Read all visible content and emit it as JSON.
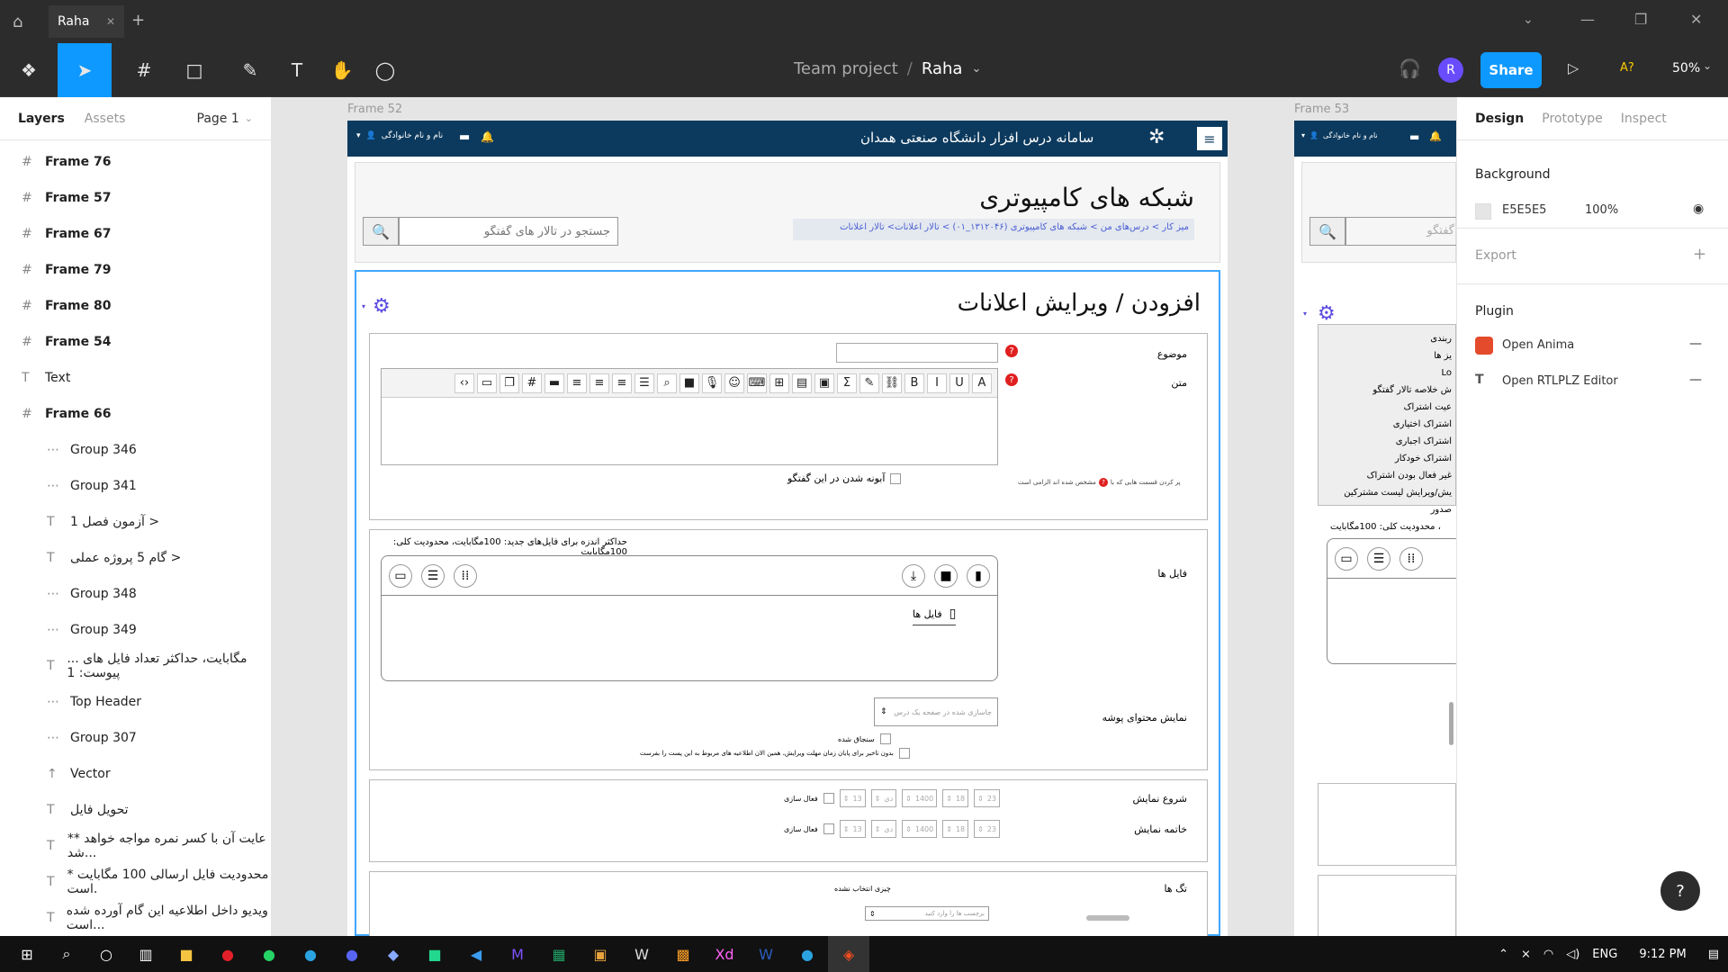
{
  "titlebar": {
    "tab_label": "Raha"
  },
  "toolbar": {
    "project": "Team project",
    "separator": "/",
    "file": "Raha",
    "share": "Share",
    "avatar_initial": "R",
    "ai_label": "A?",
    "zoom": "50%"
  },
  "layers_panel": {
    "tab_layers": "Layers",
    "tab_assets": "Assets",
    "page": "Page 1",
    "items": [
      {
        "type": "frame",
        "label": "Frame 76"
      },
      {
        "type": "frame",
        "label": "Frame 57"
      },
      {
        "type": "frame",
        "label": "Frame 67"
      },
      {
        "type": "frame",
        "label": "Frame 79"
      },
      {
        "type": "frame",
        "label": "Frame 80"
      },
      {
        "type": "frame",
        "label": "Frame 54"
      },
      {
        "type": "text",
        "label": "Text"
      },
      {
        "type": "frame",
        "label": "Frame 66"
      },
      {
        "type": "group",
        "label": "Group 346"
      },
      {
        "type": "group",
        "label": "Group 341"
      },
      {
        "type": "text",
        "label": "آزمون فصل 1 >"
      },
      {
        "type": "text",
        "label": "گام 5 پروژه عملی >"
      },
      {
        "type": "group",
        "label": "Group 348"
      },
      {
        "type": "group",
        "label": "Group 349"
      },
      {
        "type": "text",
        "label": "... مگابایت، حداکثر تعداد فایل های پیوست: 1"
      },
      {
        "type": "group",
        "label": "Top Header"
      },
      {
        "type": "group",
        "label": "Group 307"
      },
      {
        "type": "vector",
        "label": "Vector"
      },
      {
        "type": "text",
        "label": "تحویل فایل"
      },
      {
        "type": "text",
        "label": "** عایت آن با کسر نمره مواجه خواهد شد..."
      },
      {
        "type": "text",
        "label": "* محدودیت فایل ارسالی 100 مگابایت است."
      },
      {
        "type": "text",
        "label": "ویدیو داخل اطلاعیه این گام آورده شده است..."
      }
    ]
  },
  "canvas": {
    "frame52_label": "Frame 52",
    "frame53_label": "Frame 53",
    "site": {
      "user_name": "نام و نام خانوادگی",
      "site_title": "سامانه درس افزار دانشگاه صنعتی همدان",
      "course_title": "شبکه های کامپیوتری",
      "search_placeholder": "جستجو در تالار های گفتگو",
      "breadcrumb": "میز کار > درس‌های من > شبکه های کامپیوتری (۱۳۱۲۰۴۶_۰۱) > تالار اعلانات> تالار اعلانات",
      "page_heading": "افزودن / ویرایش اعلانات",
      "subject_label": "موضوع",
      "body_label": "متن",
      "subscribe_label": "آبونه شدن در این گفتگو",
      "required_note": "پر کردن قسمت هایی که با",
      "required_note2": "مشخص شده اند الزامی است",
      "files_label": "فایل ها",
      "max_size_note": "حداکثر اندزه برای فایل‌های جدید: 100مگابایت، محدودیت کلی: 100مگابایت",
      "files_folder": "فایل ها",
      "show_content_label": "نمایش محتوای پوشه",
      "select_placeholder": "جاسازی شده در صفحه یک درس",
      "option_graded": "سنجاق شده",
      "option_no_delay": "بدون تاخیر برای پایان زمان مهلت ویرایش، همین الان اطلاعیه های مربوط به این پست را بفرست",
      "start_label": "شروع نمایش",
      "end_label": "خاتمه نمایش",
      "enable_label": "فعال سازی",
      "date_parts": [
        "23",
        "18",
        "1400",
        "دی",
        "13"
      ],
      "tags_label": "تگ ها",
      "tags_none": "چیزی انتخاب نشده",
      "tags_placeholder": "برچسب ها را وارد کنید"
    },
    "frame53": {
      "user_name": "نام و نام خانوادگی",
      "search_placeholder": "گفتگو",
      "menu_items": [
        "ربندی",
        "یز ها",
        "Lo",
        "ش خلاصه تالار گفتگو",
        "عیت اشتراک",
        "اشتراک اختیاری",
        "اشتراک اجباری",
        "اشتراک خودکار",
        "غیر فعال بودن اشتراک",
        "یش/ویرایش لیست مشترکین",
        "صدور"
      ],
      "max_note": "، محدودیت کلی: 100مگابایت"
    }
  },
  "design_panel": {
    "tabs": [
      "Design",
      "Prototype",
      "Inspect"
    ],
    "background_title": "Background",
    "bg_hex": "E5E5E5",
    "bg_opacity": "100%",
    "bg_color": "#E5E5E5",
    "export_title": "Export",
    "plugin_title": "Plugin",
    "plugins": [
      "Open Anima",
      "Open RTLPLZ Editor"
    ]
  },
  "taskbar": {
    "lang": "ENG",
    "time": "9:12 PM"
  }
}
